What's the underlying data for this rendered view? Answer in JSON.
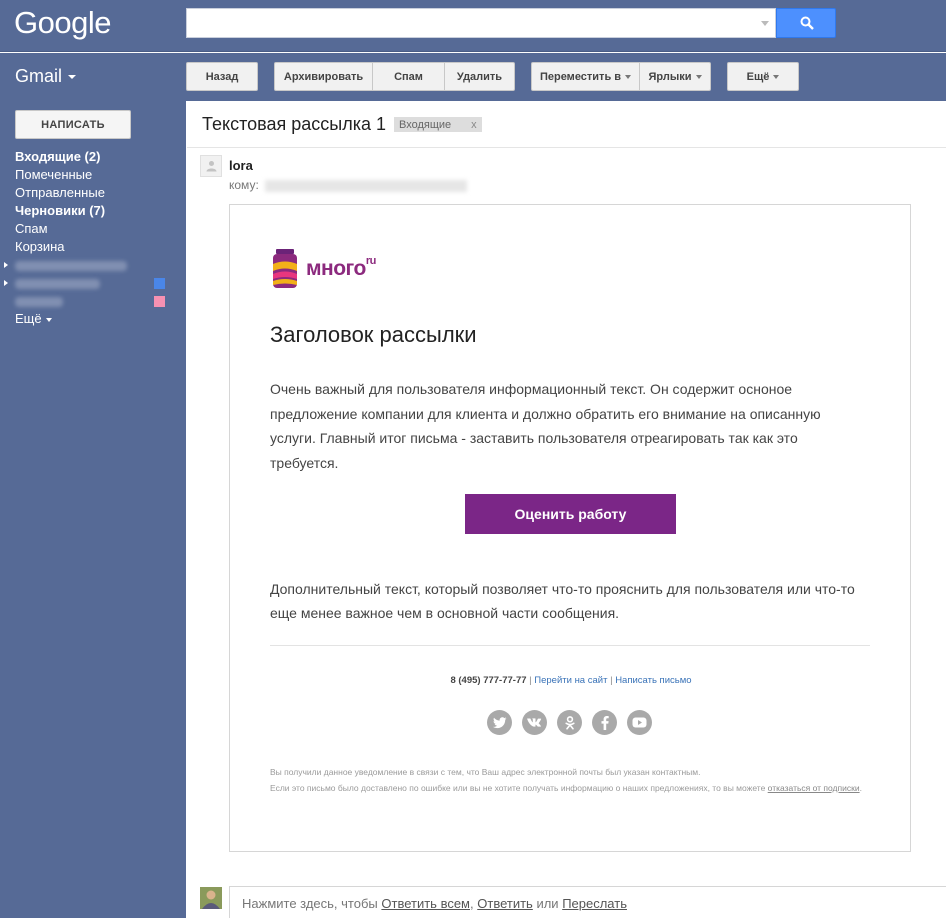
{
  "header": {
    "logo": "Google",
    "search": {
      "value": "",
      "placeholder": ""
    }
  },
  "toolbar": {
    "app_label": "Gmail",
    "back": "Назад",
    "archive": "Архивировать",
    "spam": "Спам",
    "delete": "Удалить",
    "move_to": "Переместить в",
    "labels": "Ярлыки",
    "more": "Ещё"
  },
  "sidebar": {
    "compose": "НАПИСАТЬ",
    "items": [
      {
        "label": "Входящие (2)",
        "bold": true
      },
      {
        "label": "Помеченные",
        "bold": false
      },
      {
        "label": "Отправленные",
        "bold": false
      },
      {
        "label": "Черновики (7)",
        "bold": true
      },
      {
        "label": "Спам",
        "bold": false
      },
      {
        "label": "Корзина",
        "bold": false
      }
    ],
    "more": "Ещё",
    "label_colors": [
      "#4a86e8",
      "#f691b2"
    ]
  },
  "message": {
    "subject": "Текстовая рассылка 1",
    "tag": "Входящие",
    "tag_close": "x",
    "sender": "lora",
    "to_label": "кому:"
  },
  "email": {
    "brand": "много",
    "brand_suffix": "ru",
    "heading": "Заголовок рассылки",
    "body": "Очень важный для пользователя информационный текст. Он содержит осноное предложение компании для клиента и должно обратить его внимание на описанную услуги. Главный итог письма - заставить пользователя отреагировать так как это требуется.",
    "cta": "Оценить работу",
    "extra": "Дополнительный текст, который позволяет что-то прояснить для пользователя или что-то еще менее важное чем в основной части сообщения.",
    "phone": "8 (495) 777-77-77",
    "site_link": "Перейти на сайт",
    "mail_link": "Написать письмо",
    "separator": "|",
    "socials": [
      "twitter-icon",
      "vk-icon",
      "odnoklassniki-icon",
      "facebook-icon",
      "youtube-icon"
    ],
    "disclaimer_1": "Вы получили данное уведомление в связи с тем, что Ваш адрес электронной почты был указан контактным.",
    "disclaimer_2": "Если это письмо было доставлено по ошибке или вы не хотите получать информацию о наших предложениях, то вы можете",
    "unsubscribe": "отказаться от подписки",
    "disclaimer_end": ".",
    "accent": "#7b2687"
  },
  "reply": {
    "prefix": "Нажмите здесь, чтобы",
    "reply_all": "Ответить всем",
    "comma": ",",
    "reply": "Ответить",
    "or": "или",
    "forward": "Переслать"
  }
}
